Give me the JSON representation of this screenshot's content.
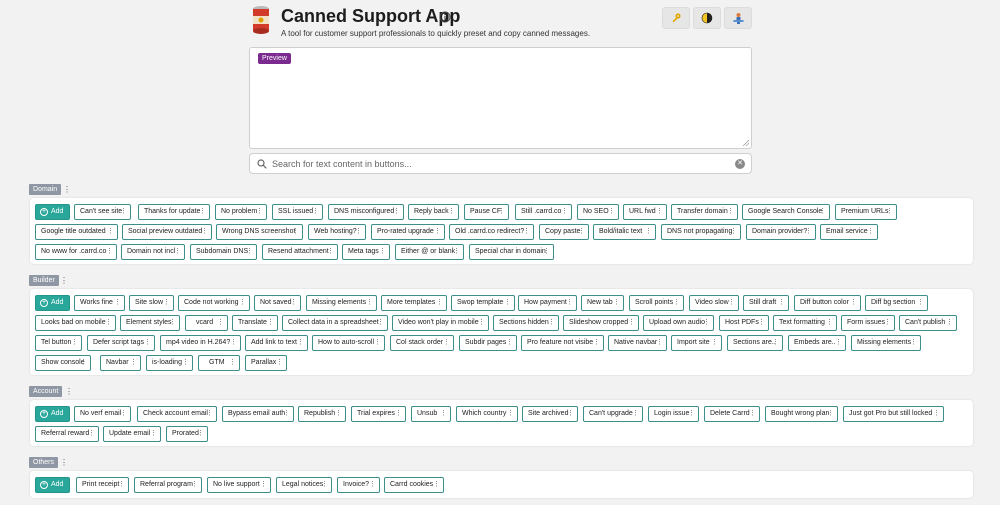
{
  "app": {
    "title": "Canned Support App",
    "subtitle": "A tool for customer support professionals to quickly preset and copy canned messages."
  },
  "top_buttons": [
    {
      "name": "key-button",
      "icon": "key-icon"
    },
    {
      "name": "theme-toggle-button",
      "icon": "half-moon-icon"
    },
    {
      "name": "user-button",
      "icon": "person-at-desk-icon"
    }
  ],
  "preview": {
    "badge": "Preview",
    "content": ""
  },
  "search": {
    "placeholder": "Search for text content in buttons...",
    "value": ""
  },
  "add_label": "Add",
  "categories": [
    {
      "name": "Domain",
      "items": [
        "Can't see site",
        "Thanks for update",
        "No problem",
        "SSL issued",
        "DNS misconfigured",
        "Reply back",
        "Pause CF",
        "Still .carrd.co",
        "No SEO",
        "URL fwd",
        "Transfer domain",
        "Google Search Console",
        "Premium URLs",
        "Google title outdated",
        "Social preview outdated",
        "Wrong DNS screenshot",
        "Web hosting?",
        "Pro-rated upgrade",
        "Old .carrd.co redirect?",
        "Copy paste",
        "Bold/italic text",
        "DNS not propagating",
        "Domain provider?",
        "Email service",
        "No www for .carrd.co",
        "Domain not incl",
        "Subdomain DNS",
        "Resend attachment",
        "Meta tags",
        "Either @ or blank",
        "Special char in domain"
      ]
    },
    {
      "name": "Builder",
      "items": [
        "Works fine",
        "Site slow",
        "Code not working",
        "Not saved",
        "Missing elements",
        "More templates",
        "Swop template",
        "How payment",
        "New tab",
        "Scroll points",
        "Video slow",
        "Still draft",
        "Diff button color",
        "Diff bg section",
        "Looks bad on mobile",
        "Element styles",
        "vcard",
        "Translate",
        "Collect data in a spreadsheet",
        "Video won't play in mobile",
        "Sections hidden",
        "Slideshow cropped",
        "Upload own audio",
        "Host PDFs",
        "Text formatting",
        "Form issues",
        "Can't publish",
        "Tel button",
        "Defer script tags",
        "mp4 video in H.264?",
        "Add link to text",
        "How to auto-scroll",
        "Col stack order",
        "Subdir pages",
        "Pro feature not visibe",
        "Native navbar",
        "Import site",
        "Sections are..",
        "Embeds are..",
        "Missing elements",
        "Show console",
        "Navbar",
        "is-loading",
        "GTM",
        "Parallax"
      ]
    },
    {
      "name": "Account",
      "items": [
        "No verf email",
        "Check account email",
        "Bypass email auth",
        "Republish",
        "Trial expires",
        "Unsub",
        "Which country",
        "Site archived",
        "Can't upgrade",
        "Login issue",
        "Delete Carrd",
        "Bought wrong plan",
        "Just got Pro but still locked",
        "Referral reward",
        "Update email",
        "Prorated"
      ]
    },
    {
      "name": "Others",
      "items": [
        "Print receipt",
        "Referral program",
        "No live support",
        "Legal notices",
        "Invoice?",
        "Carrd cookies"
      ]
    }
  ],
  "colors": {
    "accent": "#2aa79b",
    "chip_border": "#3d8f8a",
    "badge": "#7b2a8f",
    "category_label": "#8e97a3"
  }
}
